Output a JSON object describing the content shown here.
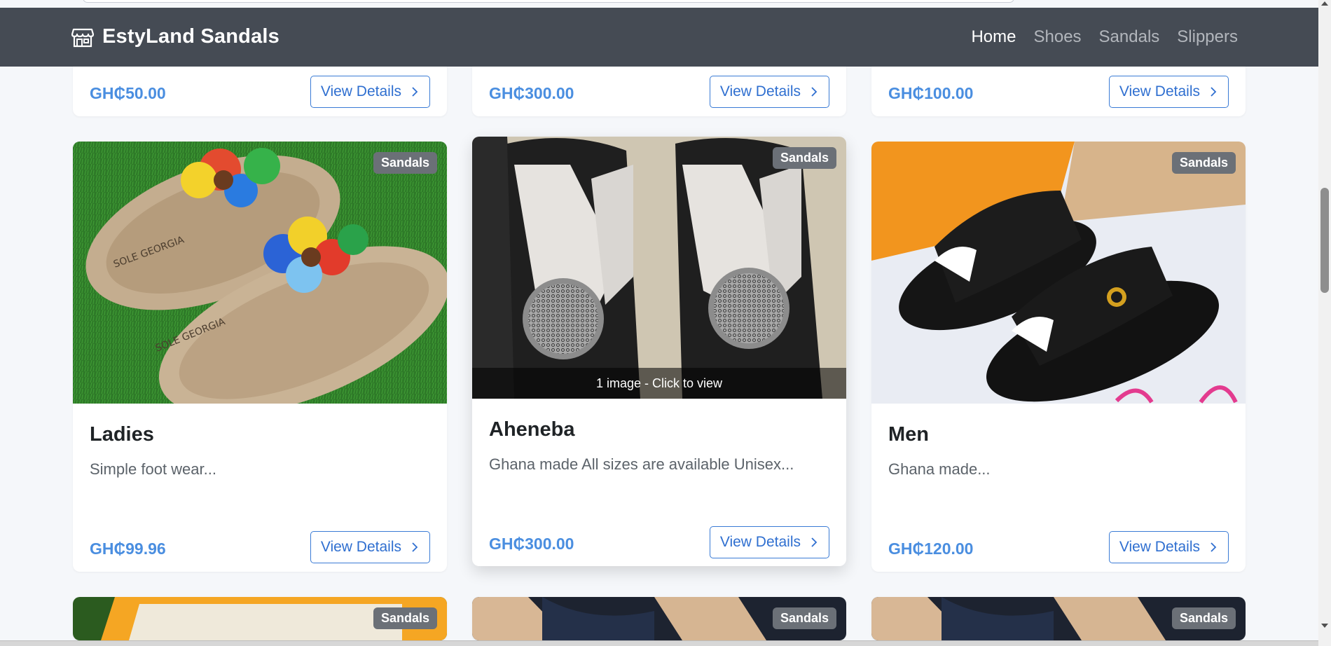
{
  "app": {
    "brand": "EstyLand Sandals",
    "nav": [
      {
        "label": "Home",
        "active": true
      },
      {
        "label": "Shoes",
        "active": false
      },
      {
        "label": "Sandals",
        "active": false
      },
      {
        "label": "Slippers",
        "active": false
      }
    ]
  },
  "top_row": [
    {
      "price": "GH₵50.00",
      "button": "View Details"
    },
    {
      "price": "GH₵300.00",
      "button": "View Details"
    },
    {
      "price": "GH₵100.00",
      "button": "View Details"
    }
  ],
  "products": [
    {
      "badge": "Sandals",
      "title": "Ladies",
      "description": "Simple foot wear...",
      "price": "GH₵99.96",
      "button": "View Details"
    },
    {
      "badge": "Sandals",
      "title": "Aheneba",
      "description": "Ghana made All sizes are available Unisex...",
      "price": "GH₵300.00",
      "button": "View Details",
      "overlay": "1 image - Click to view"
    },
    {
      "badge": "Sandals",
      "title": "Men",
      "description": "Ghana made...",
      "price": "GH₵120.00",
      "button": "View Details"
    }
  ],
  "bottom_row": [
    {
      "badge": "Sandals"
    },
    {
      "badge": "Sandals"
    },
    {
      "badge": "Sandals"
    }
  ],
  "icons": {
    "brand_icon": "storefront-icon",
    "button_icon": "chevron-right-icon"
  },
  "colors": {
    "navbar": "#454b54",
    "price": "#4a8ee0",
    "button_border": "#3a7bd5",
    "badge": "#6b7077"
  }
}
